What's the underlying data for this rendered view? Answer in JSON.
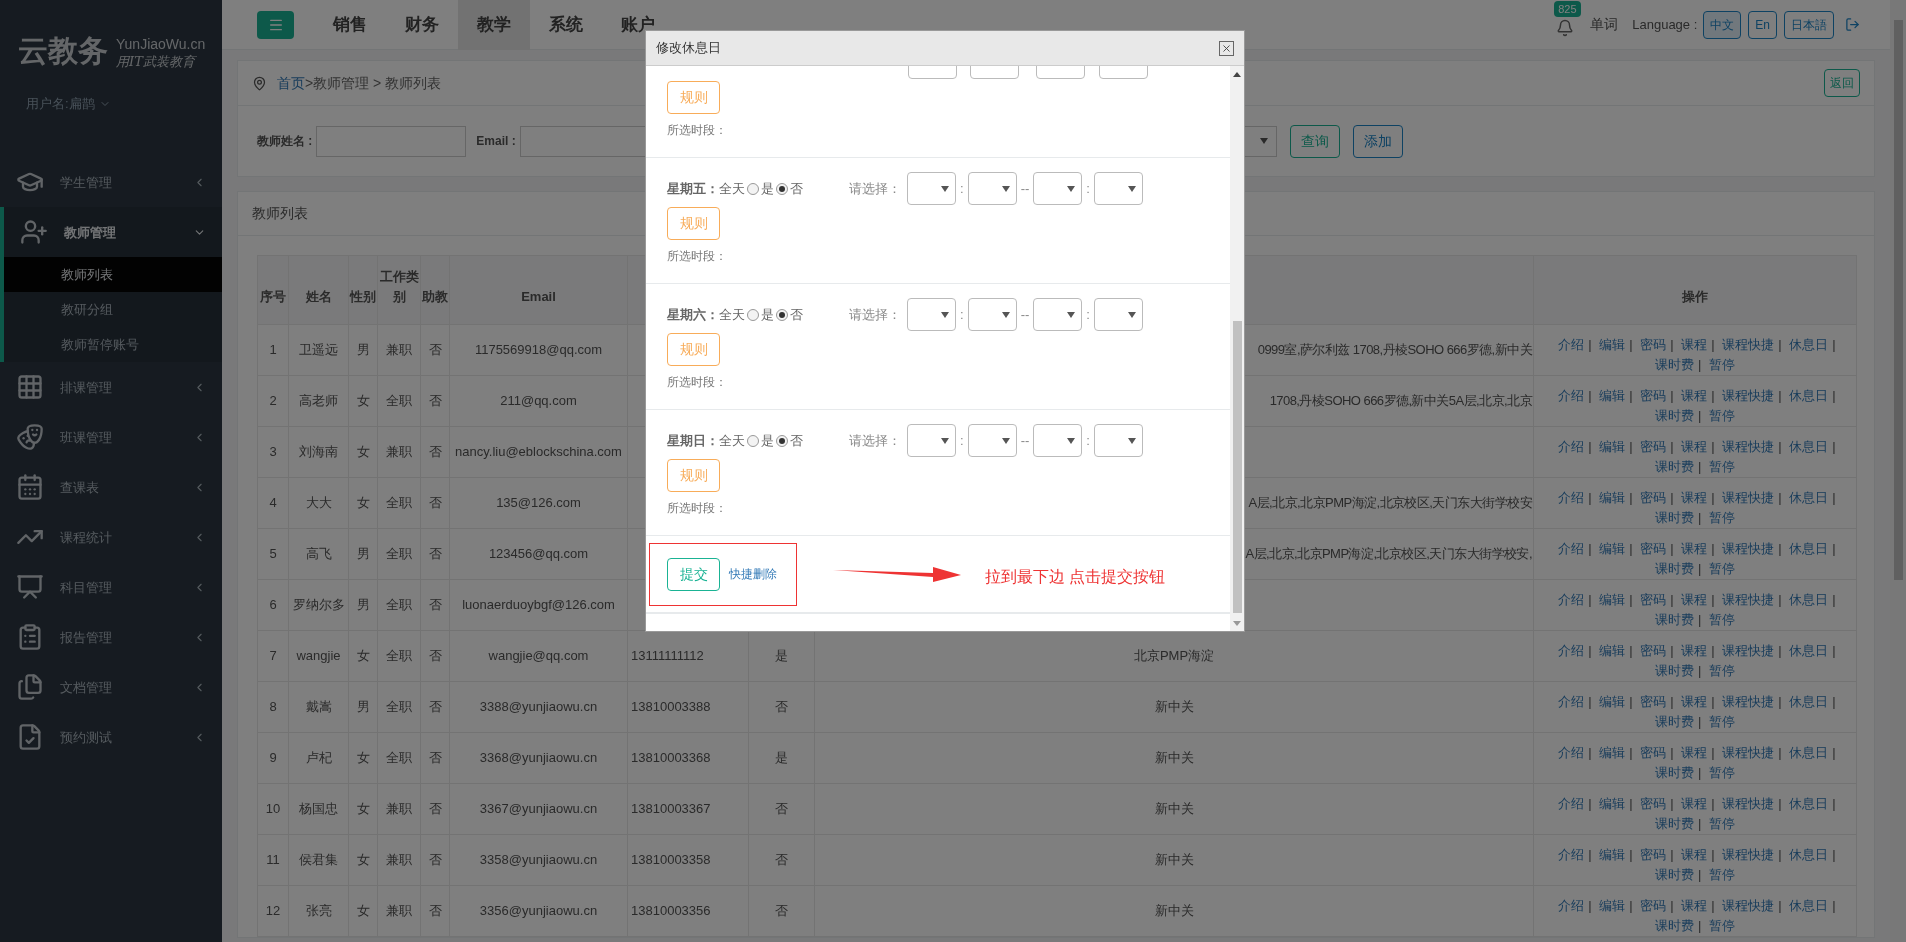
{
  "sidebar": {
    "logo": "云教务",
    "domain": "YunJiaoWu.cn",
    "slogan": "用IT武装教育",
    "user": "用户名:扁鹊",
    "items": [
      {
        "label": "学生管理",
        "expanded": false
      },
      {
        "label": "教师管理",
        "expanded": true,
        "children": [
          {
            "label": "教师列表",
            "selected": true
          },
          {
            "label": "教研分组",
            "selected": false
          },
          {
            "label": "教师暂停账号",
            "selected": false
          }
        ]
      },
      {
        "label": "排课管理",
        "expanded": false
      },
      {
        "label": "班课管理",
        "expanded": false
      },
      {
        "label": "查课表",
        "expanded": false
      },
      {
        "label": "课程统计",
        "expanded": false
      },
      {
        "label": "科目管理",
        "expanded": false
      },
      {
        "label": "报告管理",
        "expanded": false
      },
      {
        "label": "文档管理",
        "expanded": false
      },
      {
        "label": "预约测试",
        "expanded": false
      }
    ]
  },
  "topbar": {
    "tabs": [
      {
        "label": "销售",
        "selected": false
      },
      {
        "label": "财务",
        "selected": false
      },
      {
        "label": "教学",
        "selected": true
      },
      {
        "label": "系统",
        "selected": false
      },
      {
        "label": "账户",
        "selected": false
      }
    ],
    "notification_count": "825",
    "word_link": "单词",
    "language_label": "Language :",
    "languages": [
      {
        "label": "中文",
        "selected": true
      },
      {
        "label": "En",
        "selected": false
      },
      {
        "label": "日本語",
        "selected": false
      }
    ]
  },
  "breadcrumb": {
    "home": "首页",
    "path": ">教师管理 > 教师列表",
    "back_button": "返回"
  },
  "search": {
    "fields": [
      {
        "label": "教师姓名 :"
      },
      {
        "label": "Email :"
      }
    ],
    "buttons": [
      "查询",
      "添加"
    ]
  },
  "panel": {
    "title": "教师列表"
  },
  "table": {
    "columns": [
      "序号",
      "姓名",
      "性别",
      "工作类别",
      "助教",
      "Email",
      "操作"
    ],
    "separator": "|",
    "rows": [
      {
        "no": "1",
        "name": "卫遥远",
        "gender": "男",
        "work_type": "兼职",
        "assistant": "否",
        "email": "1175569918@qq.com",
        "column_9": "0999室,萨尔利兹 1708,丹棱SOHO 666罗德,新中关",
        "actions": [
          "介绍",
          "编辑",
          "密码",
          "课程",
          "课程快捷",
          "休息日",
          "课时费",
          "暂停"
        ]
      },
      {
        "no": "2",
        "name": "高老师",
        "gender": "女",
        "work_type": "全职",
        "assistant": "否",
        "email": "211@qq.com",
        "column_9": "1708,丹棱SOHO 666罗德,新中关5A层,北京,北京",
        "actions": [
          "介绍",
          "编辑",
          "密码",
          "课程",
          "课程快捷",
          "休息日",
          "课时费",
          "暂停"
        ]
      },
      {
        "no": "3",
        "name": "刘海南",
        "gender": "女",
        "work_type": "兼职",
        "assistant": "否",
        "email": "nancy.liu@eblockschina.com",
        "actions": [
          "介绍",
          "编辑",
          "密码",
          "课程",
          "课程快捷",
          "休息日",
          "课时费",
          "暂停"
        ]
      },
      {
        "no": "4",
        "name": "大大",
        "gender": "女",
        "work_type": "全职",
        "assistant": "否",
        "email": "135@126.com",
        "column_9": "A层,北京,北京PMP海淀,北京校区,天门东大街学校安",
        "actions": [
          "介绍",
          "编辑",
          "密码",
          "课程",
          "课程快捷",
          "休息日",
          "课时费",
          "暂停"
        ]
      },
      {
        "no": "5",
        "name": "高飞",
        "gender": "男",
        "work_type": "全职",
        "assistant": "否",
        "email": "123456@qq.com",
        "column_9": "A层,北京,北京PMP海淀,北京校区,天门东大街学校安,",
        "actions": [
          "介绍",
          "编辑",
          "密码",
          "课程",
          "课程快捷",
          "休息日",
          "课时费",
          "暂停"
        ]
      },
      {
        "no": "6",
        "name": "罗纳尔多",
        "gender": "男",
        "work_type": "全职",
        "assistant": "否",
        "email": "luonaerduoybgf@126.com",
        "actions": [
          "介绍",
          "编辑",
          "密码",
          "课程",
          "课程快捷",
          "休息日",
          "课时费",
          "暂停"
        ]
      },
      {
        "no": "7",
        "name": "wangjie",
        "gender": "女",
        "work_type": "全职",
        "assistant": "否",
        "email": "wangjie@qq.com",
        "column_7": "13111111112",
        "column_8": "是",
        "column_9": "北京PMP海淀",
        "actions": [
          "介绍",
          "编辑",
          "密码",
          "课程",
          "课程快捷",
          "休息日",
          "课时费",
          "暂停"
        ]
      },
      {
        "no": "8",
        "name": "戴嵩",
        "gender": "男",
        "work_type": "全职",
        "assistant": "否",
        "email": "3388@yunjiaowu.cn",
        "column_7": "13810003388",
        "column_8": "否",
        "column_9": "新中关",
        "actions": [
          "介绍",
          "编辑",
          "密码",
          "课程",
          "课程快捷",
          "休息日",
          "课时费",
          "暂停"
        ]
      },
      {
        "no": "9",
        "name": "卢杞",
        "gender": "女",
        "work_type": "全职",
        "assistant": "否",
        "email": "3368@yunjiaowu.cn",
        "column_7": "13810003368",
        "column_8": "是",
        "column_9": "新中关",
        "actions": [
          "介绍",
          "编辑",
          "密码",
          "课程",
          "课程快捷",
          "休息日",
          "课时费",
          "暂停"
        ]
      },
      {
        "no": "10",
        "name": "杨国忠",
        "gender": "女",
        "work_type": "兼职",
        "assistant": "否",
        "email": "3367@yunjiaowu.cn",
        "column_7": "13810003367",
        "column_8": "否",
        "column_9": "新中关",
        "actions": [
          "介绍",
          "编辑",
          "密码",
          "课程",
          "课程快捷",
          "休息日",
          "课时费",
          "暂停"
        ]
      },
      {
        "no": "11",
        "name": "侯君集",
        "gender": "女",
        "work_type": "兼职",
        "assistant": "否",
        "email": "3358@yunjiaowu.cn",
        "column_7": "13810003358",
        "column_8": "否",
        "column_9": "新中关",
        "actions": [
          "介绍",
          "编辑",
          "密码",
          "课程",
          "课程快捷",
          "休息日",
          "课时费",
          "暂停"
        ]
      },
      {
        "no": "12",
        "name": "张亮",
        "gender": "女",
        "work_type": "兼职",
        "assistant": "否",
        "email": "3356@yunjiaowu.cn",
        "column_7": "13810003356",
        "column_8": "否",
        "column_9": "新中关",
        "actions": [
          "介绍",
          "编辑",
          "密码",
          "课程",
          "课程快捷",
          "休息日",
          "课时费",
          "暂停"
        ]
      }
    ]
  },
  "modal": {
    "title": "修改休息日",
    "days": [
      {
        "kind": "partial",
        "rule_button": "规则",
        "period_label": "所选时段："
      },
      {
        "kind": "full",
        "label": "星期五：",
        "all_day_label": "全天",
        "options": [
          {
            "label": "是",
            "selected": false
          },
          {
            "label": "否",
            "selected": true
          }
        ],
        "select_label": "请选择：",
        "separators": [
          ":",
          "--",
          ":"
        ],
        "rule_button": "规则",
        "period_label": "所选时段："
      },
      {
        "kind": "full",
        "label": "星期六：",
        "all_day_label": "全天",
        "options": [
          {
            "label": "是",
            "selected": false
          },
          {
            "label": "否",
            "selected": true
          }
        ],
        "select_label": "请选择：",
        "separators": [
          ":",
          "--",
          ":"
        ],
        "rule_button": "规则",
        "period_label": "所选时段："
      },
      {
        "kind": "full",
        "label": "星期日：",
        "all_day_label": "全天",
        "options": [
          {
            "label": "是",
            "selected": false
          },
          {
            "label": "否",
            "selected": true
          }
        ],
        "select_label": "请选择：",
        "separators": [
          ":",
          "--",
          ":"
        ],
        "rule_button": "规则",
        "period_label": "所选时段："
      }
    ],
    "submit_button": "提交",
    "quick_delete_link": "快捷删除",
    "annotation": "拉到最下边 点击提交按钮"
  }
}
